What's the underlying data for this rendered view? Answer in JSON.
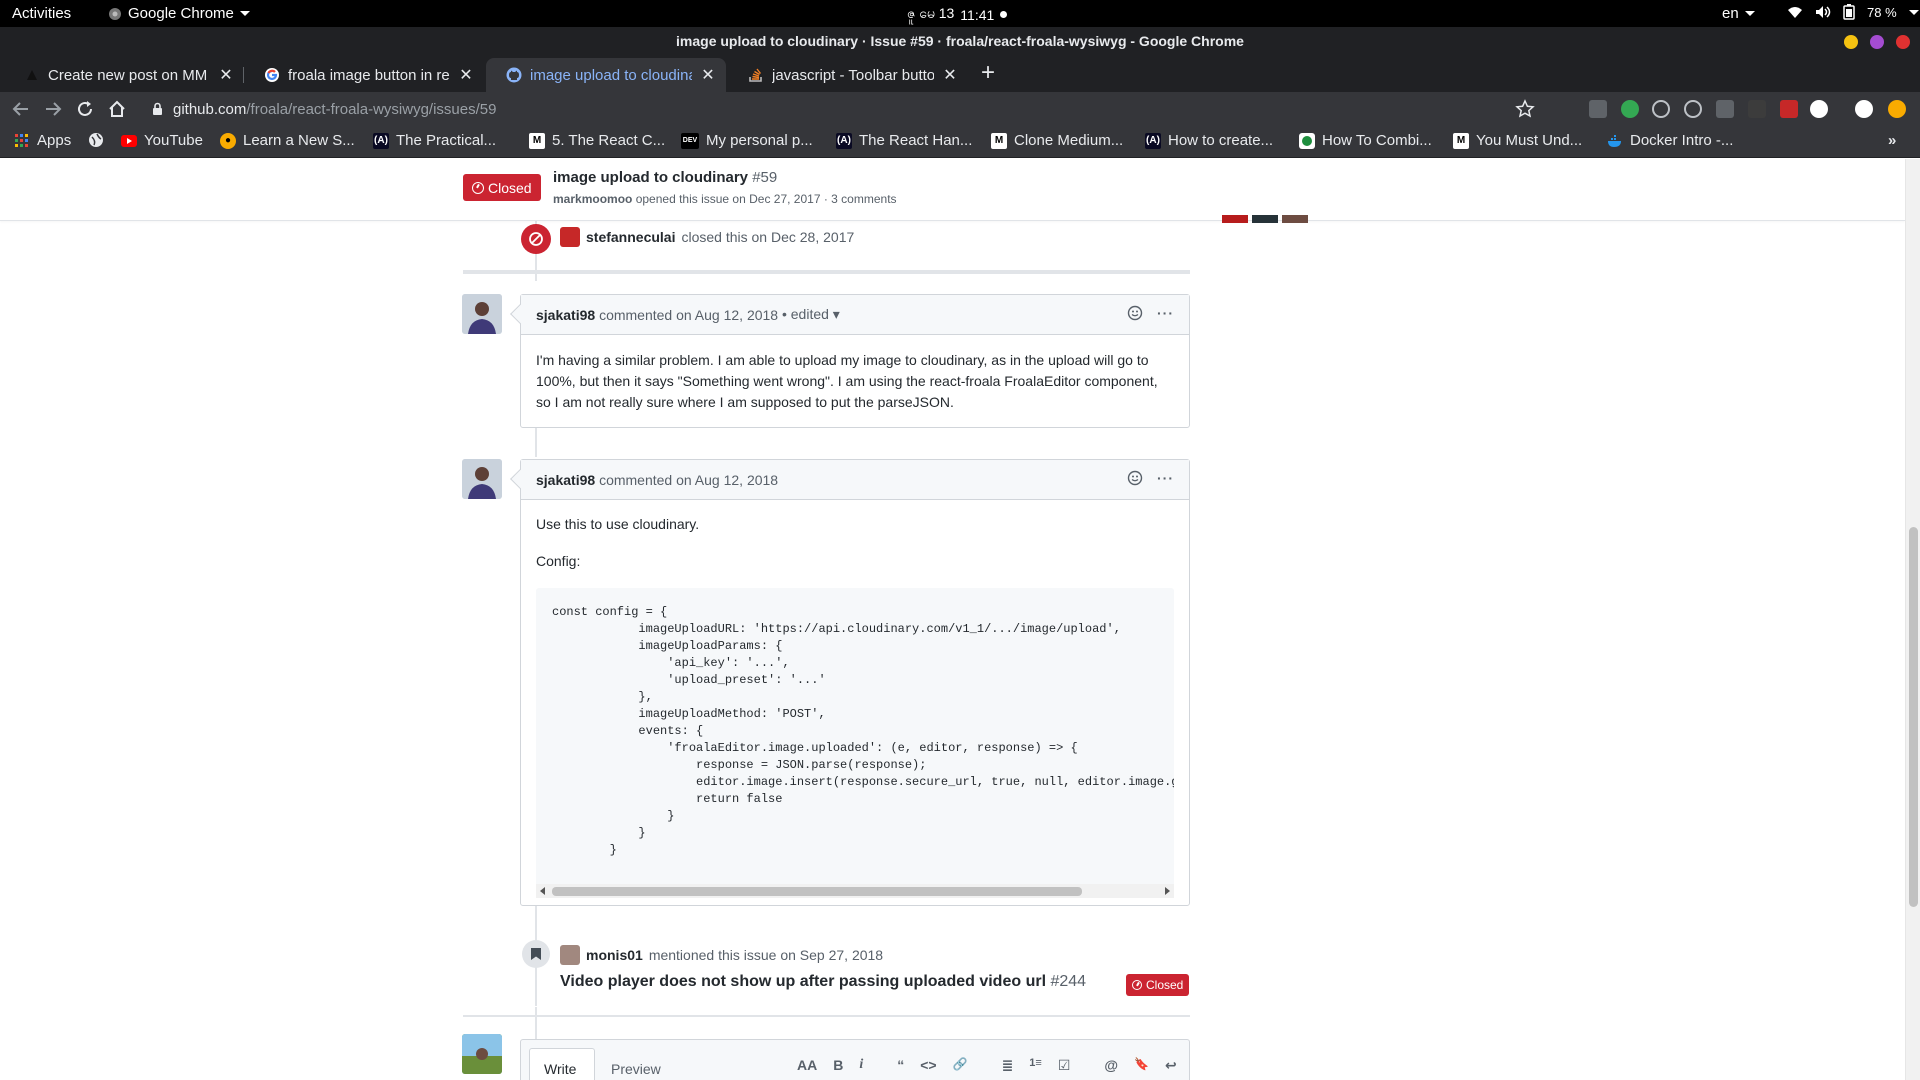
{
  "os_bar": {
    "activities": "Activities",
    "app_name": "Google Chrome",
    "clock_date": "ဇူ မေ 13",
    "clock_time": "11:41",
    "lang": "en",
    "battery": "78 %"
  },
  "window": {
    "title": "image upload to cloudinary · Issue #59 · froala/react-froala-wysiwyg - Google Chrome"
  },
  "tabs": [
    {
      "label": "Create new post on MM Su"
    },
    {
      "label": "froala image button in rea"
    },
    {
      "label": "image upload to cloudina"
    },
    {
      "label": "javascript - Toolbar butto"
    }
  ],
  "address": {
    "host": "github.com",
    "path": "/froala/react-froala-wysiwyg/issues/59"
  },
  "bookmarks": [
    {
      "label": "Apps"
    },
    {
      "label": ""
    },
    {
      "label": "YouTube"
    },
    {
      "label": "Learn a New S..."
    },
    {
      "label": "The Practical..."
    },
    {
      "label": "5. The React C..."
    },
    {
      "label": "My personal p..."
    },
    {
      "label": "The React Han..."
    },
    {
      "label": "Clone Medium..."
    },
    {
      "label": "How to create..."
    },
    {
      "label": "How To Combi..."
    },
    {
      "label": "You Must Und..."
    },
    {
      "label": "Docker Intro -..."
    }
  ],
  "bookmark_badges": {
    "dev": "DEV",
    "medium": "M",
    "fcc": "(A)"
  },
  "issue": {
    "state": "Closed",
    "title": "image upload to cloudinary",
    "number": "#59",
    "author": "markmoomoo",
    "meta": "opened this issue on Dec 27, 2017 · 3 comments"
  },
  "timeline": {
    "closed_event": {
      "user": "stefanneculai",
      "text": "closed this on Dec 28, 2017"
    },
    "comment1": {
      "user": "sjakati98",
      "meta": "commented on Aug 12, 2018",
      "edited": "• edited",
      "body": "I'm having a similar problem. I am able to upload my image to cloudinary, as in the upload will go to 100%, but then it says \"Something went wrong\". I am using the react-froala FroalaEditor component, so I am not really sure where I am supposed to put the parseJSON."
    },
    "comment2": {
      "user": "sjakati98",
      "meta": "commented on Aug 12, 2018",
      "p1": "Use this to use cloudinary.",
      "p2": "Config:",
      "code": "const config = {\n            imageUploadURL: 'https://api.cloudinary.com/v1_1/.../image/upload',\n            imageUploadParams: {\n                'api_key': '...',\n                'upload_preset': '...'\n            },\n            imageUploadMethod: 'POST',\n            events: {\n                'froalaEditor.image.uploaded': (e, editor, response) => {\n                    response = JSON.parse(response);\n                    editor.image.insert(response.secure_url, true, null, editor.image.get(), response);\n                    return false\n                }\n            }\n        }"
    },
    "mention": {
      "user": "monis01",
      "text": "mentioned this issue on Sep 27, 2018",
      "ref_title": "Video player does not show up after passing uploaded video url",
      "ref_number": "#244",
      "ref_state": "Closed"
    }
  },
  "editor": {
    "tab_write": "Write",
    "tab_preview": "Preview",
    "tools": [
      "AA",
      "B",
      "i",
      "“",
      "<>",
      "🔗",
      "≣",
      "1≡",
      "☑",
      "@",
      "🔖",
      "↩"
    ]
  },
  "colors": {
    "closed_red": "#cb2431",
    "chrome_dark": "#202124",
    "chrome_toolbar": "#35363a",
    "active_tab_text": "#8ab4f8"
  }
}
